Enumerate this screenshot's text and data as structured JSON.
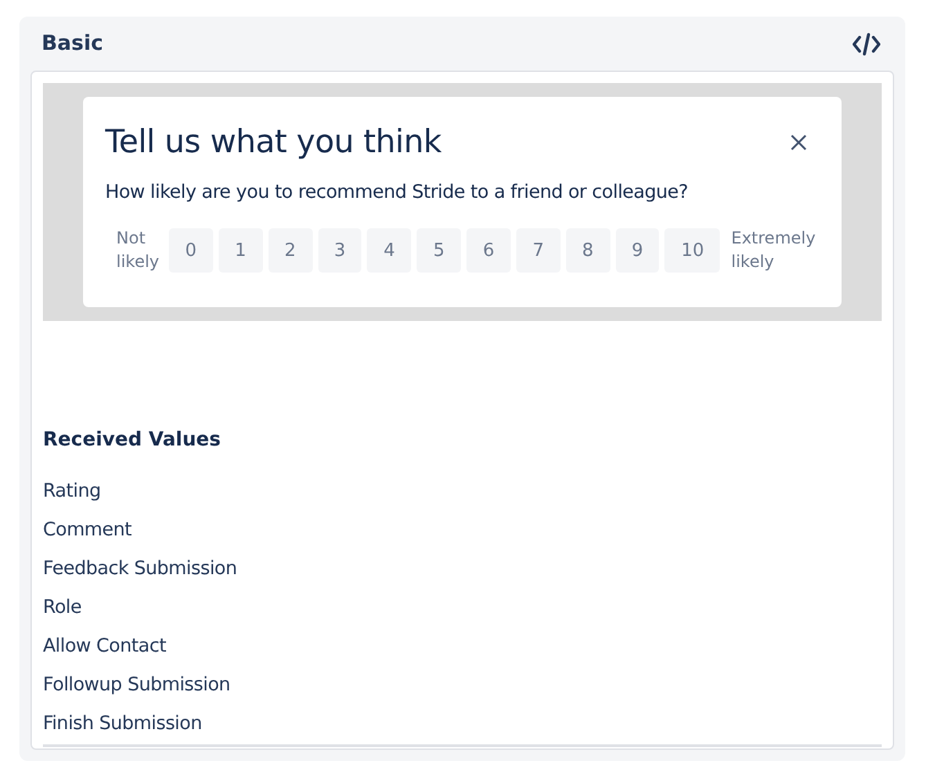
{
  "panel": {
    "title": "Basic"
  },
  "dialog": {
    "title": "Tell us what you think",
    "question": "How likely are you to recommend Stride to a friend or colleague?",
    "low_label": "Not likely",
    "high_label": "Extremely likely",
    "scale": [
      {
        "label": "0",
        "selected": false
      },
      {
        "label": "1",
        "selected": false
      },
      {
        "label": "2",
        "selected": false
      },
      {
        "label": "3",
        "selected": false
      },
      {
        "label": "4",
        "selected": false
      },
      {
        "label": "5",
        "selected": false
      },
      {
        "label": "6",
        "selected": false
      },
      {
        "label": "7",
        "selected": false
      },
      {
        "label": "8",
        "selected": false
      },
      {
        "label": "9",
        "selected": false
      },
      {
        "label": "10",
        "selected": false
      }
    ]
  },
  "received_values": {
    "title": "Received Values",
    "items": [
      "Rating",
      "Comment",
      "Feedback Submission",
      "Role",
      "Allow Contact",
      "Followup Submission",
      "Finish Submission"
    ]
  }
}
